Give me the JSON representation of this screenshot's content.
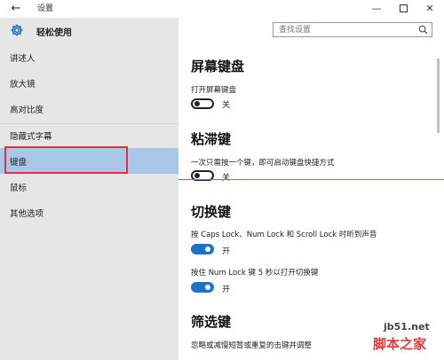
{
  "window": {
    "title": "设置",
    "back_icon": "back-arrow-icon",
    "minimize_glyph": "—",
    "close_glyph": "✕"
  },
  "sidebar": {
    "header_title": "轻松使用",
    "header_icon": "gear-icon",
    "items": [
      {
        "label": "讲述人"
      },
      {
        "label": "放大镜"
      },
      {
        "label": "高对比度"
      },
      {
        "label": "隐藏式字幕"
      },
      {
        "label": "键盘",
        "selected": true
      },
      {
        "label": "鼠标"
      },
      {
        "label": "其他选项"
      }
    ]
  },
  "search": {
    "placeholder": "查找设置",
    "icon": "search-icon"
  },
  "main": {
    "sections": [
      {
        "heading": "屏幕键盘",
        "settings": [
          {
            "description": "打开屏幕键盘",
            "state": "关",
            "on": false
          }
        ]
      },
      {
        "heading": "粘滞键",
        "settings": [
          {
            "description": "一次只需按一个键，即可启动键盘快捷方式",
            "state": "关",
            "on": false
          }
        ]
      },
      {
        "heading": "切换键",
        "settings": [
          {
            "description": "按 Caps Lock、Num Lock 和 Scroll Lock 时听到声音",
            "state": "开",
            "on": true
          },
          {
            "description": "按住 Num Lock 键 5 秒以打开切换键",
            "state": "开",
            "on": true
          }
        ]
      },
      {
        "heading": "筛选键",
        "settings": [
          {
            "description": "忽略或减慢短暂或重复的击键并调整"
          }
        ]
      }
    ]
  },
  "watermark": {
    "site": "jb51.net",
    "brand": "脚本之家"
  },
  "colors": {
    "accent": "#1a73c8",
    "selected": "#a9c7e6",
    "sidebar_bg": "#e6e6e6",
    "highlight_red": "#e0323a"
  }
}
